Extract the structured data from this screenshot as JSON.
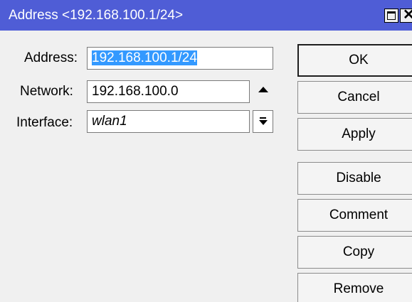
{
  "window": {
    "title": "Address <192.168.100.1/24>",
    "close_glyph": "✕"
  },
  "form": {
    "address_label": "Address:",
    "address_value": "192.168.100.1/24",
    "network_label": "Network:",
    "network_value": "192.168.100.0",
    "interface_label": "Interface:",
    "interface_value": "wlan1"
  },
  "buttons": {
    "ok": "OK",
    "cancel": "Cancel",
    "apply": "Apply",
    "disable": "Disable",
    "comment": "Comment",
    "copy": "Copy",
    "remove": "Remove"
  },
  "icons": {
    "maximize": "maximize-icon",
    "close": "close-icon",
    "collapse": "triangle-up-icon",
    "dropdown": "dropdown-arrow-icon"
  },
  "colors": {
    "titlebar": "#4f5dd6",
    "selection": "#3399ff",
    "background": "#f0f0f0"
  }
}
